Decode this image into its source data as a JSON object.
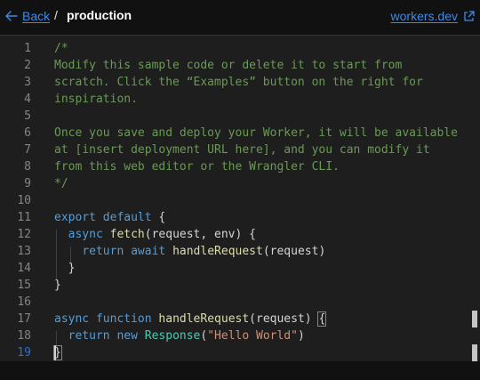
{
  "header": {
    "back_label": "Back",
    "separator": "/",
    "project_name": "production",
    "external_link_label": "workers.dev"
  },
  "editor": {
    "active_line": 19,
    "lines": [
      {
        "n": "1",
        "tokens": [
          {
            "t": "/*",
            "c": "comment"
          }
        ]
      },
      {
        "n": "2",
        "tokens": [
          {
            "t": "Modify this sample code or delete it to start from",
            "c": "comment"
          }
        ]
      },
      {
        "n": "3",
        "tokens": [
          {
            "t": "scratch. Click the “Examples” button on the right for",
            "c": "comment"
          }
        ]
      },
      {
        "n": "4",
        "tokens": [
          {
            "t": "inspiration.",
            "c": "comment"
          }
        ]
      },
      {
        "n": "5",
        "tokens": []
      },
      {
        "n": "6",
        "tokens": [
          {
            "t": "Once you save and deploy your Worker, it will be available",
            "c": "comment"
          }
        ]
      },
      {
        "n": "7",
        "tokens": [
          {
            "t": "at [insert deployment URL here], and you can modify it",
            "c": "comment"
          }
        ]
      },
      {
        "n": "8",
        "tokens": [
          {
            "t": "from this web editor or the Wrangler CLI.",
            "c": "comment"
          }
        ]
      },
      {
        "n": "9",
        "tokens": [
          {
            "t": "*/",
            "c": "comment"
          }
        ]
      },
      {
        "n": "10",
        "tokens": []
      },
      {
        "n": "11",
        "tokens": [
          {
            "t": "export",
            "c": "kw"
          },
          {
            "t": " ",
            "c": "plain"
          },
          {
            "t": "default",
            "c": "kw"
          },
          {
            "t": " {",
            "c": "plain"
          }
        ]
      },
      {
        "n": "12",
        "tokens": [
          {
            "t": "  ",
            "c": "plain"
          },
          {
            "t": "async",
            "c": "kw"
          },
          {
            "t": " ",
            "c": "plain"
          },
          {
            "t": "fetch",
            "c": "fn"
          },
          {
            "t": "(request, env) {",
            "c": "plain"
          }
        ]
      },
      {
        "n": "13",
        "tokens": [
          {
            "t": "    ",
            "c": "plain"
          },
          {
            "t": "return",
            "c": "kw"
          },
          {
            "t": " ",
            "c": "plain"
          },
          {
            "t": "await",
            "c": "kw"
          },
          {
            "t": " ",
            "c": "plain"
          },
          {
            "t": "handleRequest",
            "c": "fn"
          },
          {
            "t": "(request)",
            "c": "plain"
          }
        ]
      },
      {
        "n": "14",
        "tokens": [
          {
            "t": "  }",
            "c": "plain"
          }
        ]
      },
      {
        "n": "15",
        "tokens": [
          {
            "t": "}",
            "c": "plain"
          }
        ]
      },
      {
        "n": "16",
        "tokens": []
      },
      {
        "n": "17",
        "tokens": [
          {
            "t": "async",
            "c": "kw"
          },
          {
            "t": " ",
            "c": "plain"
          },
          {
            "t": "function",
            "c": "kw"
          },
          {
            "t": " ",
            "c": "plain"
          },
          {
            "t": "handleRequest",
            "c": "fn"
          },
          {
            "t": "(request) ",
            "c": "plain"
          },
          {
            "t": "{",
            "c": "plain",
            "match": true
          }
        ]
      },
      {
        "n": "18",
        "tokens": [
          {
            "t": "  ",
            "c": "plain"
          },
          {
            "t": "return",
            "c": "kw"
          },
          {
            "t": " ",
            "c": "plain"
          },
          {
            "t": "new",
            "c": "kw"
          },
          {
            "t": " ",
            "c": "plain"
          },
          {
            "t": "Response",
            "c": "type"
          },
          {
            "t": "(",
            "c": "plain"
          },
          {
            "t": "\"Hello World\"",
            "c": "str"
          },
          {
            "t": ")",
            "c": "plain"
          }
        ]
      },
      {
        "n": "19",
        "tokens": [
          {
            "t": "}",
            "c": "plain",
            "match": true
          }
        ]
      }
    ]
  },
  "colors": {
    "accent_link": "#3a8be8",
    "active_line_number": "#2f6fd0",
    "comment": "#6a9955",
    "keyword": "#569cd6",
    "function": "#dcdcaa",
    "string": "#ce9178",
    "type": "#4ec9b0"
  }
}
